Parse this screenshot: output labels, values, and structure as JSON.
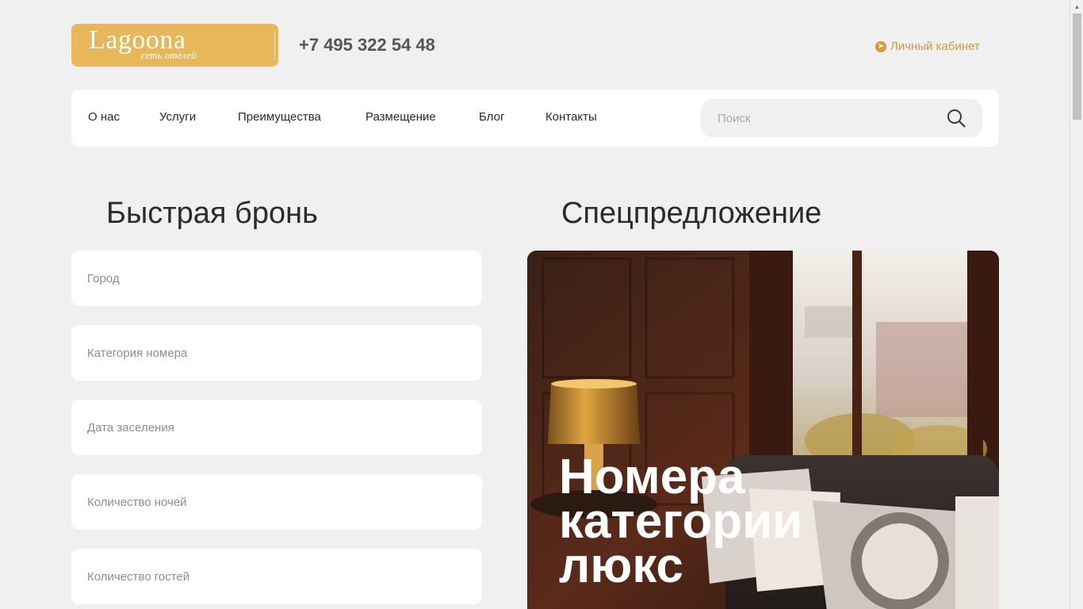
{
  "logo": {
    "name": "Lagoona",
    "tagline": "сеть отелей"
  },
  "header": {
    "phone": "+7 495 322 54 48",
    "account_label": "Личный кабинет"
  },
  "nav": {
    "items": [
      {
        "label": "О нас"
      },
      {
        "label": "Услуги"
      },
      {
        "label": "Преимущества"
      },
      {
        "label": "Размещение"
      },
      {
        "label": "Блог"
      },
      {
        "label": "Контакты"
      }
    ],
    "search_placeholder": "Поиск",
    "search_value": ""
  },
  "booking": {
    "title": "Быстрая бронь",
    "fields": [
      {
        "placeholder": "Город",
        "value": ""
      },
      {
        "placeholder": "Категория номера",
        "value": ""
      },
      {
        "placeholder": "Дата заселения",
        "value": ""
      },
      {
        "placeholder": "Количество ночей",
        "value": ""
      },
      {
        "placeholder": "Количество гостей",
        "value": ""
      }
    ]
  },
  "offer": {
    "title": "Спецпредложение",
    "card_line1": "Номера",
    "card_line2": "категории",
    "card_line3": "люкс"
  },
  "colors": {
    "accent": "#d39a3c",
    "logo_bg": "#e8b75a",
    "page_bg": "#f0f0f0",
    "card_bg": "#ffffff"
  },
  "icons": [
    "sun-icon",
    "arrow-circle-icon",
    "search-icon"
  ]
}
